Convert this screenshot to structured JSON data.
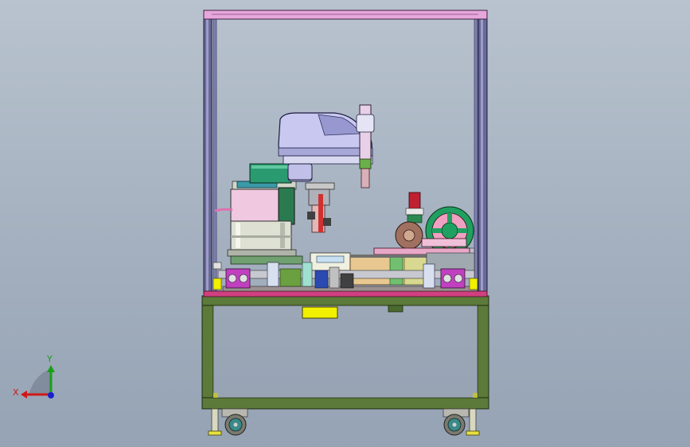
{
  "axis_triad": {
    "x_label": "X",
    "y_label": "Y",
    "x_color": "#d01818",
    "y_color": "#18a018",
    "z_color": "#1820d0"
  },
  "colors": {
    "frame_purple": "#5a5a86",
    "frame_top_pink": "#e8a0d8",
    "base_green": "#5c7a3a",
    "table_magenta": "#d04080",
    "robot_lavender": "#c8c8f0",
    "accent_yellow": "#f0f000",
    "accent_green": "#20a060",
    "bowl_pink": "#f0c8e0",
    "bowl_silver": "#dce0d4"
  }
}
